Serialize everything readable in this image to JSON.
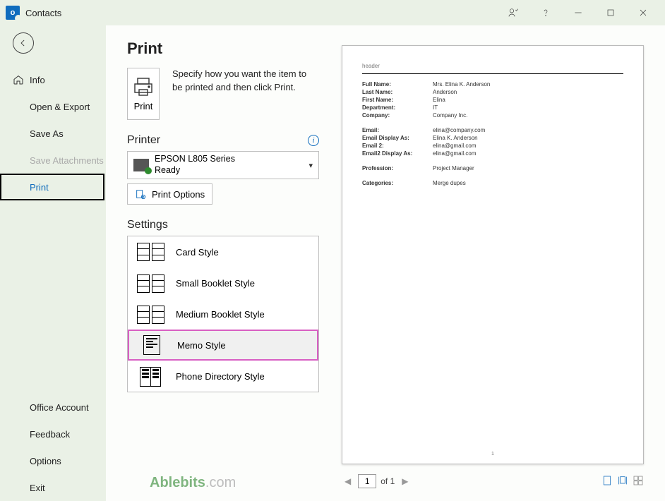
{
  "window": {
    "title": "Contacts"
  },
  "sidebar": {
    "info": "Info",
    "open_export": "Open & Export",
    "save_as": "Save As",
    "save_attachments": "Save Attachments",
    "print": "Print",
    "office_account": "Office Account",
    "feedback": "Feedback",
    "options": "Options",
    "exit": "Exit"
  },
  "print": {
    "heading": "Print",
    "button_label": "Print",
    "description": "Specify how you want the item to be printed and then click Print."
  },
  "printer": {
    "section": "Printer",
    "name": "EPSON L805 Series",
    "status": "Ready",
    "options_button": "Print Options"
  },
  "settings": {
    "section": "Settings",
    "styles": {
      "card": "Card Style",
      "small_booklet": "Small Booklet Style",
      "medium_booklet": "Medium Booklet Style",
      "memo": "Memo Style",
      "phone": "Phone Directory Style"
    }
  },
  "preview": {
    "header": "header",
    "rows": {
      "full_name_k": "Full Name:",
      "full_name_v": "Mrs. Elina K. Anderson",
      "last_name_k": "Last Name:",
      "last_name_v": "Anderson",
      "first_name_k": "First Name:",
      "first_name_v": "Elina",
      "department_k": "Department:",
      "department_v": "IT",
      "company_k": "Company:",
      "company_v": "Company Inc.",
      "email_k": "Email:",
      "email_v": "elina@company.com",
      "email_disp_k": "Email Display As:",
      "email_disp_v": "Elina K. Anderson",
      "email2_k": "Email 2:",
      "email2_v": "elina@gmail.com",
      "email2_disp_k": "Email2 Display As:",
      "email2_disp_v": "elina@gmail.com",
      "profession_k": "Profession:",
      "profession_v": "Project Manager",
      "categories_k": "Categories:",
      "categories_v": "Merge dupes"
    },
    "page_number": "1"
  },
  "pager": {
    "current": "1",
    "of_text": "of 1"
  },
  "watermark": {
    "brand": "Ablebits",
    "suffix": ".com"
  }
}
